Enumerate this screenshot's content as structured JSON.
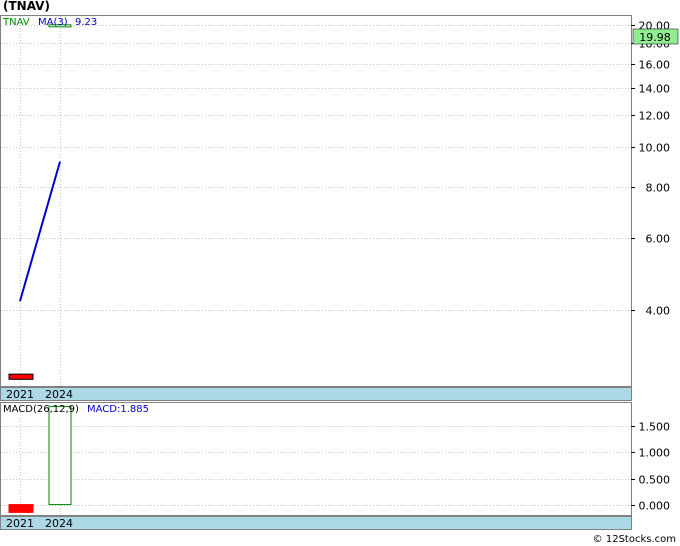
{
  "header": {
    "title": "(TNAV)",
    "credit": "© 12Stocks.com"
  },
  "colors": {
    "up": "#008800",
    "down": "#ff0000",
    "ma": "#0000cc",
    "band": "#add8e6",
    "grid": "#c8c8c8",
    "price_label": "#90ee90"
  },
  "chart_data": [
    {
      "type": "candlestick",
      "categories": [
        "2021",
        "2024"
      ],
      "legend": {
        "ticker": "TNAV",
        "ma_label": "MA(3)",
        "ma_value": "9.23"
      },
      "scale": "log",
      "ylim": [
        2.6,
        21.0
      ],
      "yticks": [
        4.0,
        6.0,
        8.0,
        10.0,
        12.0,
        14.0,
        16.0,
        18.0,
        20.0
      ],
      "ytick_labels": [
        "4.00",
        "6.00",
        "8.00",
        "10.00",
        "12.00",
        "14.00",
        "16.00",
        "18.00",
        "20.00"
      ],
      "last_price": 19.98,
      "last_price_label": "19.98",
      "candles": [
        {
          "x": "2021",
          "open": 2.78,
          "close": 2.7,
          "high": 2.78,
          "low": 2.7
        },
        {
          "x": "2024",
          "open": 19.96,
          "close": 19.98,
          "high": 19.98,
          "low": 19.96
        }
      ],
      "ma_line": [
        {
          "x": "2021",
          "y": 4.2
        },
        {
          "x": "2024",
          "y": 9.23
        }
      ]
    },
    {
      "type": "bar",
      "categories": [
        "2021",
        "2024"
      ],
      "legend": {
        "label": "MACD(26,12,9)",
        "value_label": "MACD:1.885"
      },
      "ylim": [
        -0.2,
        1.95
      ],
      "yticks": [
        0.0,
        0.5,
        1.0,
        1.5
      ],
      "ytick_labels": [
        "0.000",
        "0.500",
        "1.000",
        "1.500"
      ],
      "values": [
        -0.15,
        1.885
      ]
    }
  ]
}
